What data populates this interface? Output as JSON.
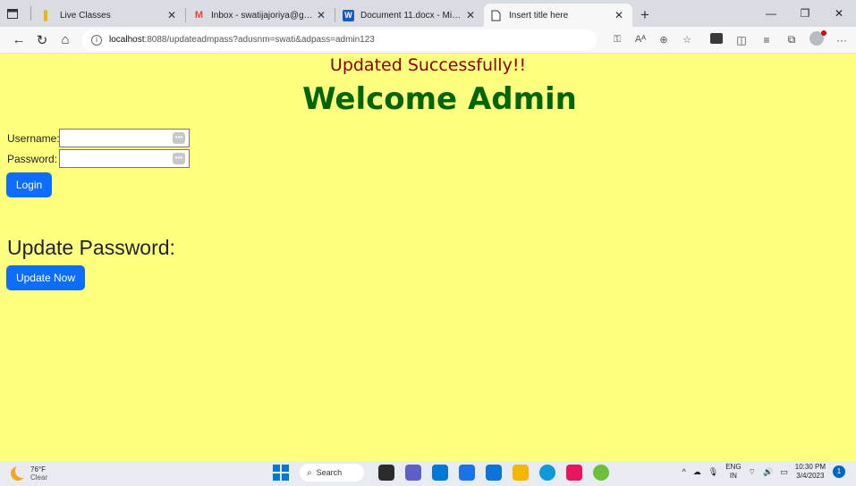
{
  "browser": {
    "tabs": [
      {
        "title": "Live Classes",
        "favicon": "bookmark-icon",
        "color": "#f2b705",
        "active": false
      },
      {
        "title": "Inbox - swatijajoriya@gmail.com",
        "favicon": "gmail-icon",
        "color": "#ea4335",
        "active": false
      },
      {
        "title": "Document 11.docx - Microsoft W",
        "favicon": "word-icon",
        "color": "#185abd",
        "active": false
      },
      {
        "title": "Insert title here",
        "favicon": "page-icon",
        "color": "#ffffff",
        "active": true
      }
    ],
    "url_host": "localhost",
    "url_rest": ":8088/updateadmpass?adusnm=swati&adpass=admin123"
  },
  "page": {
    "background": "#ffff80",
    "success_message": "Updated Successfully!!",
    "success_color": "#8b0000",
    "heading": "Welcome Admin",
    "heading_color": "#006400",
    "username_label": "Username:",
    "username_value": "",
    "password_label": "Password:",
    "password_value": "",
    "login_button": "Login",
    "update_heading": "Update Password:",
    "update_button": "Update Now",
    "button_color": "#0d6efd"
  },
  "taskbar": {
    "weather_temp": "76°F",
    "weather_desc": "Clear",
    "search_label": "Search",
    "lang_top": "ENG",
    "lang_bottom": "IN",
    "time": "10:30 PM",
    "date": "3/4/2023",
    "notification_count": "1"
  }
}
